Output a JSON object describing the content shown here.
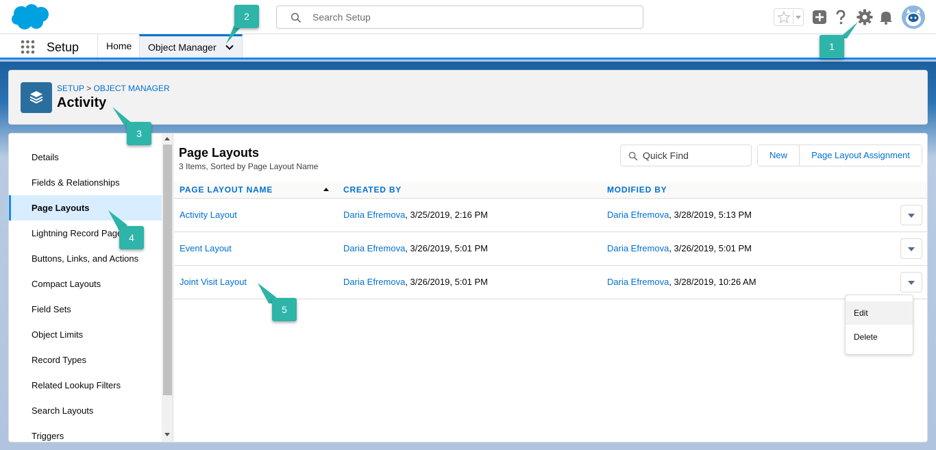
{
  "header": {
    "search_placeholder": "Search Setup"
  },
  "nav": {
    "app_name": "Setup",
    "tabs": [
      {
        "label": "Home"
      },
      {
        "label": "Object Manager"
      }
    ]
  },
  "page_header": {
    "breadcrumb_setup": "SETUP",
    "breadcrumb_sep": ">",
    "breadcrumb_object_manager": "OBJECT MANAGER",
    "title": "Activity"
  },
  "sidebar": {
    "items": [
      {
        "label": "Details"
      },
      {
        "label": "Fields & Relationships"
      },
      {
        "label": "Page Layouts"
      },
      {
        "label": "Lightning Record Pages"
      },
      {
        "label": "Buttons, Links, and Actions"
      },
      {
        "label": "Compact Layouts"
      },
      {
        "label": "Field Sets"
      },
      {
        "label": "Object Limits"
      },
      {
        "label": "Record Types"
      },
      {
        "label": "Related Lookup Filters"
      },
      {
        "label": "Search Layouts"
      },
      {
        "label": "Triggers"
      }
    ]
  },
  "list": {
    "title": "Page Layouts",
    "subtitle": "3 Items, Sorted by Page Layout Name",
    "quick_find_placeholder": "Quick Find",
    "new_button": "New",
    "assignment_button": "Page Layout Assignment",
    "columns": [
      "PAGE LAYOUT NAME",
      "CREATED BY",
      "MODIFIED BY"
    ],
    "rows": [
      {
        "name": "Activity Layout",
        "created_by": "Daria Efremova",
        "created_at": ", 3/25/2019, 2:16 PM",
        "modified_by": "Daria Efremova",
        "modified_at": ", 3/28/2019, 5:13 PM"
      },
      {
        "name": "Event Layout",
        "created_by": "Daria Efremova",
        "created_at": ", 3/26/2019, 5:01 PM",
        "modified_by": "Daria Efremova",
        "modified_at": ", 3/26/2019, 5:01 PM"
      },
      {
        "name": "Joint Visit Layout",
        "created_by": "Daria Efremova",
        "created_at": ", 3/26/2019, 5:01 PM",
        "modified_by": "Daria Efremova",
        "modified_at": ", 3/28/2019, 10:26 AM"
      }
    ],
    "row_menu": {
      "items": [
        {
          "label": "Edit"
        },
        {
          "label": "Delete"
        }
      ]
    }
  },
  "callouts": [
    "1",
    "2",
    "3",
    "4",
    "5"
  ],
  "colors": {
    "brand_blue": "#0070d2",
    "callout_teal": "#2eb4a8",
    "active_nav": "#1589ee"
  }
}
